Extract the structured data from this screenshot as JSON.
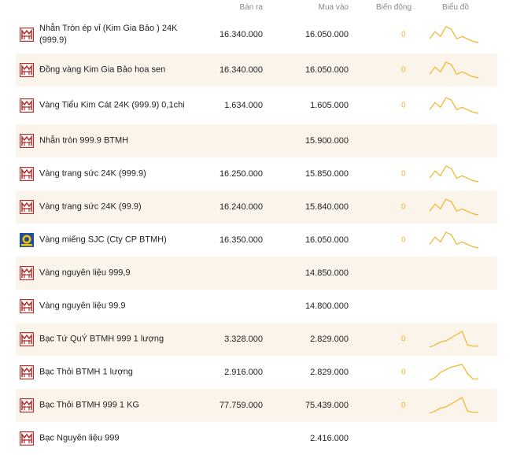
{
  "header": {
    "sell": "Bán ra",
    "buy": "Mua vào",
    "change": "Biến động",
    "chart": "Biểu đồ"
  },
  "colors": {
    "accent": "#f0b429",
    "row_alt": "#fbf4ea",
    "logo_red": "#b0312d"
  },
  "rows": [
    {
      "name": "Nhẫn Tròn ép vỉ (Kim Gia Bảo ) 24K (999.9)",
      "sell": "16.340.000",
      "buy": "16.050.000",
      "change": "0",
      "icon": "btmh-logo",
      "spark": [
        4,
        10,
        6,
        14,
        12,
        4,
        6,
        4,
        2,
        1
      ]
    },
    {
      "name": "Đồng vàng Kim Gia Bảo hoa sen",
      "sell": "16.340.000",
      "buy": "16.050.000",
      "change": "0",
      "icon": "btmh-logo",
      "spark": [
        4,
        10,
        6,
        14,
        12,
        4,
        6,
        4,
        2,
        1
      ]
    },
    {
      "name": "Vàng Tiểu Kim Cát 24K (999.9) 0,1chi",
      "sell": "1.634.000",
      "buy": "1.605.000",
      "change": "0",
      "icon": "btmh-logo",
      "spark": [
        4,
        10,
        6,
        14,
        12,
        4,
        6,
        4,
        2,
        1
      ]
    },
    {
      "name": "Nhẫn tròn 999.9 BTMH",
      "sell": "",
      "buy": "15.900.000",
      "change": "",
      "icon": "btmh-logo",
      "spark": []
    },
    {
      "name": "Vàng trang sức 24K (999.9)",
      "sell": "16.250.000",
      "buy": "15.850.000",
      "change": "0",
      "icon": "btmh-logo",
      "spark": [
        4,
        10,
        6,
        14,
        12,
        4,
        6,
        4,
        2,
        1
      ]
    },
    {
      "name": "Vàng trang sức 24K (99.9)",
      "sell": "16.240.000",
      "buy": "15.840.000",
      "change": "0",
      "icon": "btmh-logo",
      "spark": [
        4,
        10,
        6,
        14,
        12,
        4,
        6,
        4,
        2,
        1
      ]
    },
    {
      "name": "Vàng miếng SJC (Cty CP BTMH)",
      "sell": "16.350.000",
      "buy": "16.050.000",
      "change": "0",
      "icon": "sjc-logo",
      "spark": [
        4,
        10,
        6,
        14,
        12,
        4,
        6,
        4,
        2,
        1
      ]
    },
    {
      "name": "Vàng nguyên liệu 999,9",
      "sell": "",
      "buy": "14.850.000",
      "change": "",
      "icon": "btmh-logo",
      "spark": []
    },
    {
      "name": "Vàng nguyên liệu 99.9",
      "sell": "",
      "buy": "14.800.000",
      "change": "",
      "icon": "btmh-logo",
      "spark": []
    },
    {
      "name": "Bạc Tứ QuÝ BTMH 999 1 lượng",
      "sell": "3.328.000",
      "buy": "2.829.000",
      "change": "0",
      "icon": "btmh-logo",
      "spark": [
        0,
        2,
        5,
        6,
        9,
        12,
        15,
        2,
        1,
        1
      ]
    },
    {
      "name": "Bạc Thỏi BTMH 1 lượng",
      "sell": "2.916.000",
      "buy": "2.829.000",
      "change": "0",
      "icon": "btmh-logo",
      "spark": [
        0,
        2,
        6,
        8,
        10,
        11,
        12,
        5,
        1,
        1
      ]
    },
    {
      "name": "Bạc Thỏi BTMH 999 1 KG",
      "sell": "77.759.000",
      "buy": "75.439.000",
      "change": "0",
      "icon": "btmh-logo",
      "spark": [
        0,
        2,
        5,
        6,
        9,
        12,
        15,
        2,
        1,
        1
      ]
    },
    {
      "name": "Bạc Nguyên liệu 999",
      "sell": "",
      "buy": "2.416.000",
      "change": "",
      "icon": "btmh-logo",
      "spark": []
    }
  ]
}
